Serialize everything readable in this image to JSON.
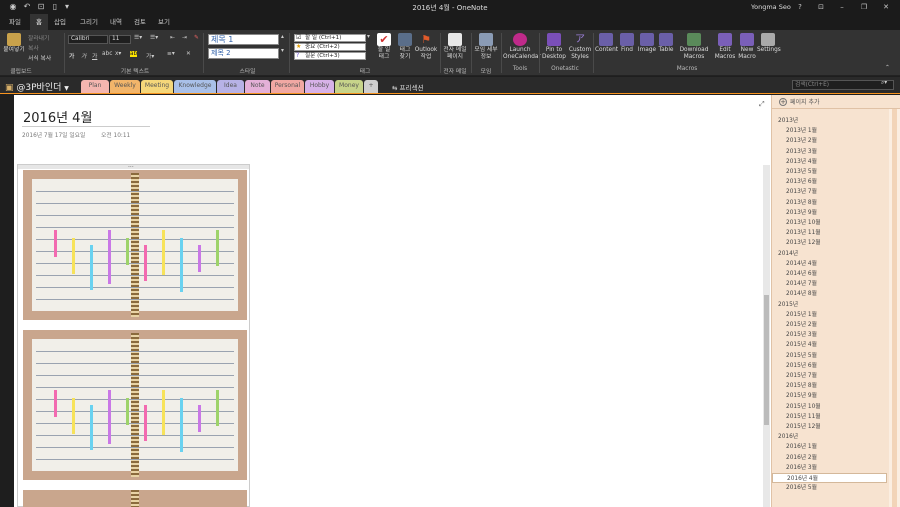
{
  "window": {
    "title": "2016년 4월 - OneNote",
    "user": "Yongma Seo",
    "help": "?",
    "controls": [
      "⊡",
      "–",
      "❐",
      "✕"
    ]
  },
  "ribbon_tabs": [
    "파일",
    "홈",
    "삽입",
    "그리기",
    "내역",
    "검토",
    "보기"
  ],
  "active_tab": "홈",
  "ribbon": {
    "clipboard": {
      "paste": "붙여넣기",
      "cut": "잘라내기",
      "copy": "복사",
      "format_painter": "서식 복사",
      "group": "클립보드"
    },
    "basic_text": {
      "font": "Calibri",
      "size": "11",
      "group": "기본 텍스트"
    },
    "styles": {
      "h1": "제목 1",
      "h2": "제목 2",
      "group": "스타일"
    },
    "tags": {
      "todo": "할 일 (Ctrl+1)",
      "important": "중요 (Ctrl+2)",
      "question": "질문 (Ctrl+3)",
      "todo_tag": "할 일\n태그",
      "find_tags": "태그\n찾기",
      "outlook": "Outlook\n작업",
      "group": "태그"
    },
    "email": {
      "label": "전자 메일\n페이지",
      "group": "전자 메일"
    },
    "meetings": {
      "label": "모임 세부\n정보",
      "group": "모임"
    },
    "tools": {
      "label": "Launch\nOneCalendar",
      "group": "Tools"
    },
    "onetastic": {
      "pin": "Pin to\nDesktop",
      "custom": "Custom\nStyles",
      "group": "Onetastic"
    },
    "macros": {
      "content": "Content",
      "find": "Find",
      "image": "Image",
      "table": "Table",
      "download": "Download\nMacros",
      "edit": "Edit\nMacros",
      "new": "New\nMacro",
      "settings": "Settings",
      "group": "Macros"
    }
  },
  "notebook": {
    "name": "@3P바인더",
    "sections": [
      {
        "label": "Plan",
        "color": "#f4b6b0"
      },
      {
        "label": "Weekly",
        "color": "#f2b56a"
      },
      {
        "label": "Meeting",
        "color": "#f5d77a"
      },
      {
        "label": "Knowledge",
        "color": "#a9c0e8"
      },
      {
        "label": "Idea",
        "color": "#b7b2e6"
      },
      {
        "label": "Note",
        "color": "#e4b0d8"
      },
      {
        "label": "Personal",
        "color": "#f1a8a3"
      },
      {
        "label": "Hobby",
        "color": "#d7b2e8"
      },
      {
        "label": "Money",
        "color": "#c7d48a"
      },
      {
        "label": "+",
        "color": "#cfcfcf"
      }
    ],
    "sync_label": "프리섹션",
    "search_placeholder": "검색(Ctrl+E)"
  },
  "page": {
    "title": "2016년 4월",
    "date": "2016년 7월 17일 일요일",
    "time": "오전 10:11",
    "expand_icon": "⤢",
    "image_handle": "..."
  },
  "page_list": {
    "add_label": "페이지 추가",
    "items": [
      {
        "label": "2013년",
        "type": "year"
      },
      {
        "label": "2013년 1월",
        "type": "month"
      },
      {
        "label": "2013년 2월",
        "type": "month"
      },
      {
        "label": "2013년 3월",
        "type": "month"
      },
      {
        "label": "2013년 4월",
        "type": "month"
      },
      {
        "label": "2013년 5월",
        "type": "month"
      },
      {
        "label": "2013년 6월",
        "type": "month"
      },
      {
        "label": "2013년 7월",
        "type": "month"
      },
      {
        "label": "2013년 8월",
        "type": "month"
      },
      {
        "label": "2013년 9월",
        "type": "month"
      },
      {
        "label": "2013년 10월",
        "type": "month"
      },
      {
        "label": "2013년 11월",
        "type": "month"
      },
      {
        "label": "2013년 12월",
        "type": "month"
      },
      {
        "label": "2014년",
        "type": "year"
      },
      {
        "label": "2014년 4월",
        "type": "month"
      },
      {
        "label": "2014년 6월",
        "type": "month"
      },
      {
        "label": "2014년 7월",
        "type": "month"
      },
      {
        "label": "2014년 8월",
        "type": "month"
      },
      {
        "label": "2015년",
        "type": "year"
      },
      {
        "label": "2015년 1월",
        "type": "month"
      },
      {
        "label": "2015년 2월",
        "type": "month"
      },
      {
        "label": "2015년 3월",
        "type": "month"
      },
      {
        "label": "2015년 4월",
        "type": "month"
      },
      {
        "label": "2015년 5월",
        "type": "month"
      },
      {
        "label": "2015년 6월",
        "type": "month"
      },
      {
        "label": "2015년 7월",
        "type": "month"
      },
      {
        "label": "2015년 8월",
        "type": "month"
      },
      {
        "label": "2015년 9월",
        "type": "month"
      },
      {
        "label": "2015년 10월",
        "type": "month"
      },
      {
        "label": "2015년 11월",
        "type": "month"
      },
      {
        "label": "2015년 12월",
        "type": "month"
      },
      {
        "label": "2016년",
        "type": "year"
      },
      {
        "label": "2016년 1월",
        "type": "month"
      },
      {
        "label": "2016년 2월",
        "type": "month"
      },
      {
        "label": "2016년 3월",
        "type": "month"
      },
      {
        "label": "2016년 4월",
        "type": "month",
        "selected": true
      },
      {
        "label": "2016년 5월",
        "type": "month"
      }
    ]
  }
}
